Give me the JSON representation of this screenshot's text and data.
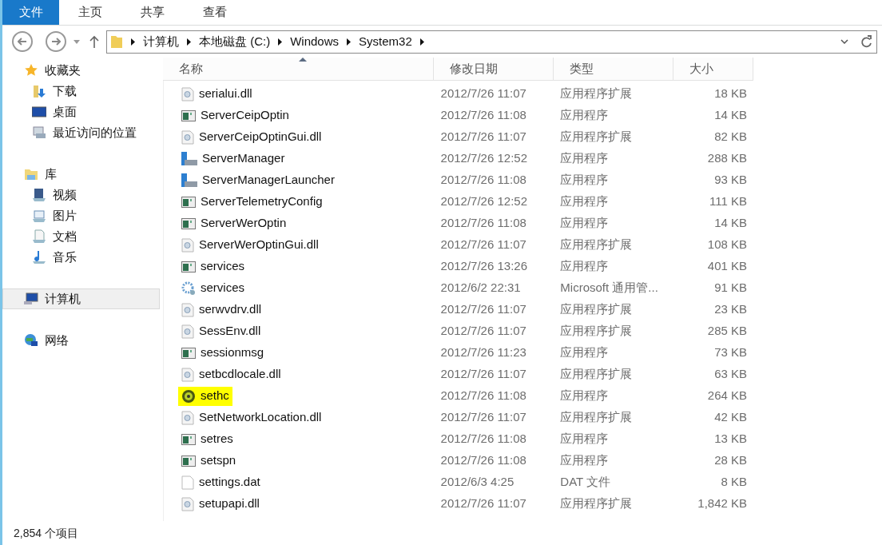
{
  "menu_tabs": [
    {
      "label": "文件",
      "selected": true
    },
    {
      "label": "主页",
      "selected": false
    },
    {
      "label": "共享",
      "selected": false
    },
    {
      "label": "查看",
      "selected": false
    }
  ],
  "breadcrumb": [
    "计算机",
    "本地磁盘 (C:)",
    "Windows",
    "System32"
  ],
  "sidebar": [
    {
      "label": "收藏夹",
      "kind": "star",
      "selected": false,
      "children": [
        {
          "label": "下载",
          "kind": "download",
          "selected": false
        },
        {
          "label": "桌面",
          "kind": "desktop",
          "selected": false
        },
        {
          "label": "最近访问的位置",
          "kind": "recent",
          "selected": false
        }
      ]
    },
    {
      "label": "库",
      "kind": "library",
      "selected": false,
      "children": [
        {
          "label": "视频",
          "kind": "video",
          "selected": false
        },
        {
          "label": "图片",
          "kind": "picture",
          "selected": false
        },
        {
          "label": "文档",
          "kind": "document",
          "selected": false
        },
        {
          "label": "音乐",
          "kind": "music",
          "selected": false
        }
      ]
    },
    {
      "label": "计算机",
      "kind": "computer",
      "selected": true
    },
    {
      "label": "网络",
      "kind": "network",
      "selected": false
    }
  ],
  "table": {
    "columns": [
      "名称",
      "修改日期",
      "类型",
      "大小"
    ],
    "rows": [
      {
        "name": "serialui.dll",
        "kind": "dll",
        "modified": "2012/7/26 11:07",
        "type": "应用程序扩展",
        "size": "18 KB",
        "highlighted": false
      },
      {
        "name": "ServerCeipOptin",
        "kind": "exe",
        "modified": "2012/7/26 11:08",
        "type": "应用程序",
        "size": "14 KB",
        "highlighted": false
      },
      {
        "name": "ServerCeipOptinGui.dll",
        "kind": "dll",
        "modified": "2012/7/26 11:07",
        "type": "应用程序扩展",
        "size": "82 KB",
        "highlighted": false
      },
      {
        "name": "ServerManager",
        "kind": "server",
        "modified": "2012/7/26 12:52",
        "type": "应用程序",
        "size": "288 KB",
        "highlighted": false
      },
      {
        "name": "ServerManagerLauncher",
        "kind": "server",
        "modified": "2012/7/26 11:08",
        "type": "应用程序",
        "size": "93 KB",
        "highlighted": false
      },
      {
        "name": "ServerTelemetryConfig",
        "kind": "exe",
        "modified": "2012/7/26 12:52",
        "type": "应用程序",
        "size": "111 KB",
        "highlighted": false
      },
      {
        "name": "ServerWerOptin",
        "kind": "exe",
        "modified": "2012/7/26 11:08",
        "type": "应用程序",
        "size": "14 KB",
        "highlighted": false
      },
      {
        "name": "ServerWerOptinGui.dll",
        "kind": "dll",
        "modified": "2012/7/26 11:07",
        "type": "应用程序扩展",
        "size": "108 KB",
        "highlighted": false
      },
      {
        "name": "services",
        "kind": "exe",
        "modified": "2012/7/26 13:26",
        "type": "应用程序",
        "size": "401 KB",
        "highlighted": false
      },
      {
        "name": "services",
        "kind": "gear",
        "modified": "2012/6/2 22:31",
        "type": "Microsoft 通用管...",
        "size": "91 KB",
        "highlighted": false
      },
      {
        "name": "serwvdrv.dll",
        "kind": "dll",
        "modified": "2012/7/26 11:07",
        "type": "应用程序扩展",
        "size": "23 KB",
        "highlighted": false
      },
      {
        "name": "SessEnv.dll",
        "kind": "dll",
        "modified": "2012/7/26 11:07",
        "type": "应用程序扩展",
        "size": "285 KB",
        "highlighted": false
      },
      {
        "name": "sessionmsg",
        "kind": "exe",
        "modified": "2012/7/26 11:23",
        "type": "应用程序",
        "size": "73 KB",
        "highlighted": false
      },
      {
        "name": "setbcdlocale.dll",
        "kind": "dll",
        "modified": "2012/7/26 11:07",
        "type": "应用程序扩展",
        "size": "63 KB",
        "highlighted": false
      },
      {
        "name": "sethc",
        "kind": "round",
        "modified": "2012/7/26 11:08",
        "type": "应用程序",
        "size": "264 KB",
        "highlighted": true
      },
      {
        "name": "SetNetworkLocation.dll",
        "kind": "dll",
        "modified": "2012/7/26 11:07",
        "type": "应用程序扩展",
        "size": "42 KB",
        "highlighted": false
      },
      {
        "name": "setres",
        "kind": "exe",
        "modified": "2012/7/26 11:08",
        "type": "应用程序",
        "size": "13 KB",
        "highlighted": false
      },
      {
        "name": "setspn",
        "kind": "exe",
        "modified": "2012/7/26 11:08",
        "type": "应用程序",
        "size": "28 KB",
        "highlighted": false
      },
      {
        "name": "settings.dat",
        "kind": "file",
        "modified": "2012/6/3 4:25",
        "type": "DAT 文件",
        "size": "8 KB",
        "highlighted": false
      },
      {
        "name": "setupapi.dll",
        "kind": "dll",
        "modified": "2012/7/26 11:07",
        "type": "应用程序扩展",
        "size": "1,842 KB",
        "highlighted": false
      }
    ]
  },
  "status_bar": "2,854 个项目"
}
